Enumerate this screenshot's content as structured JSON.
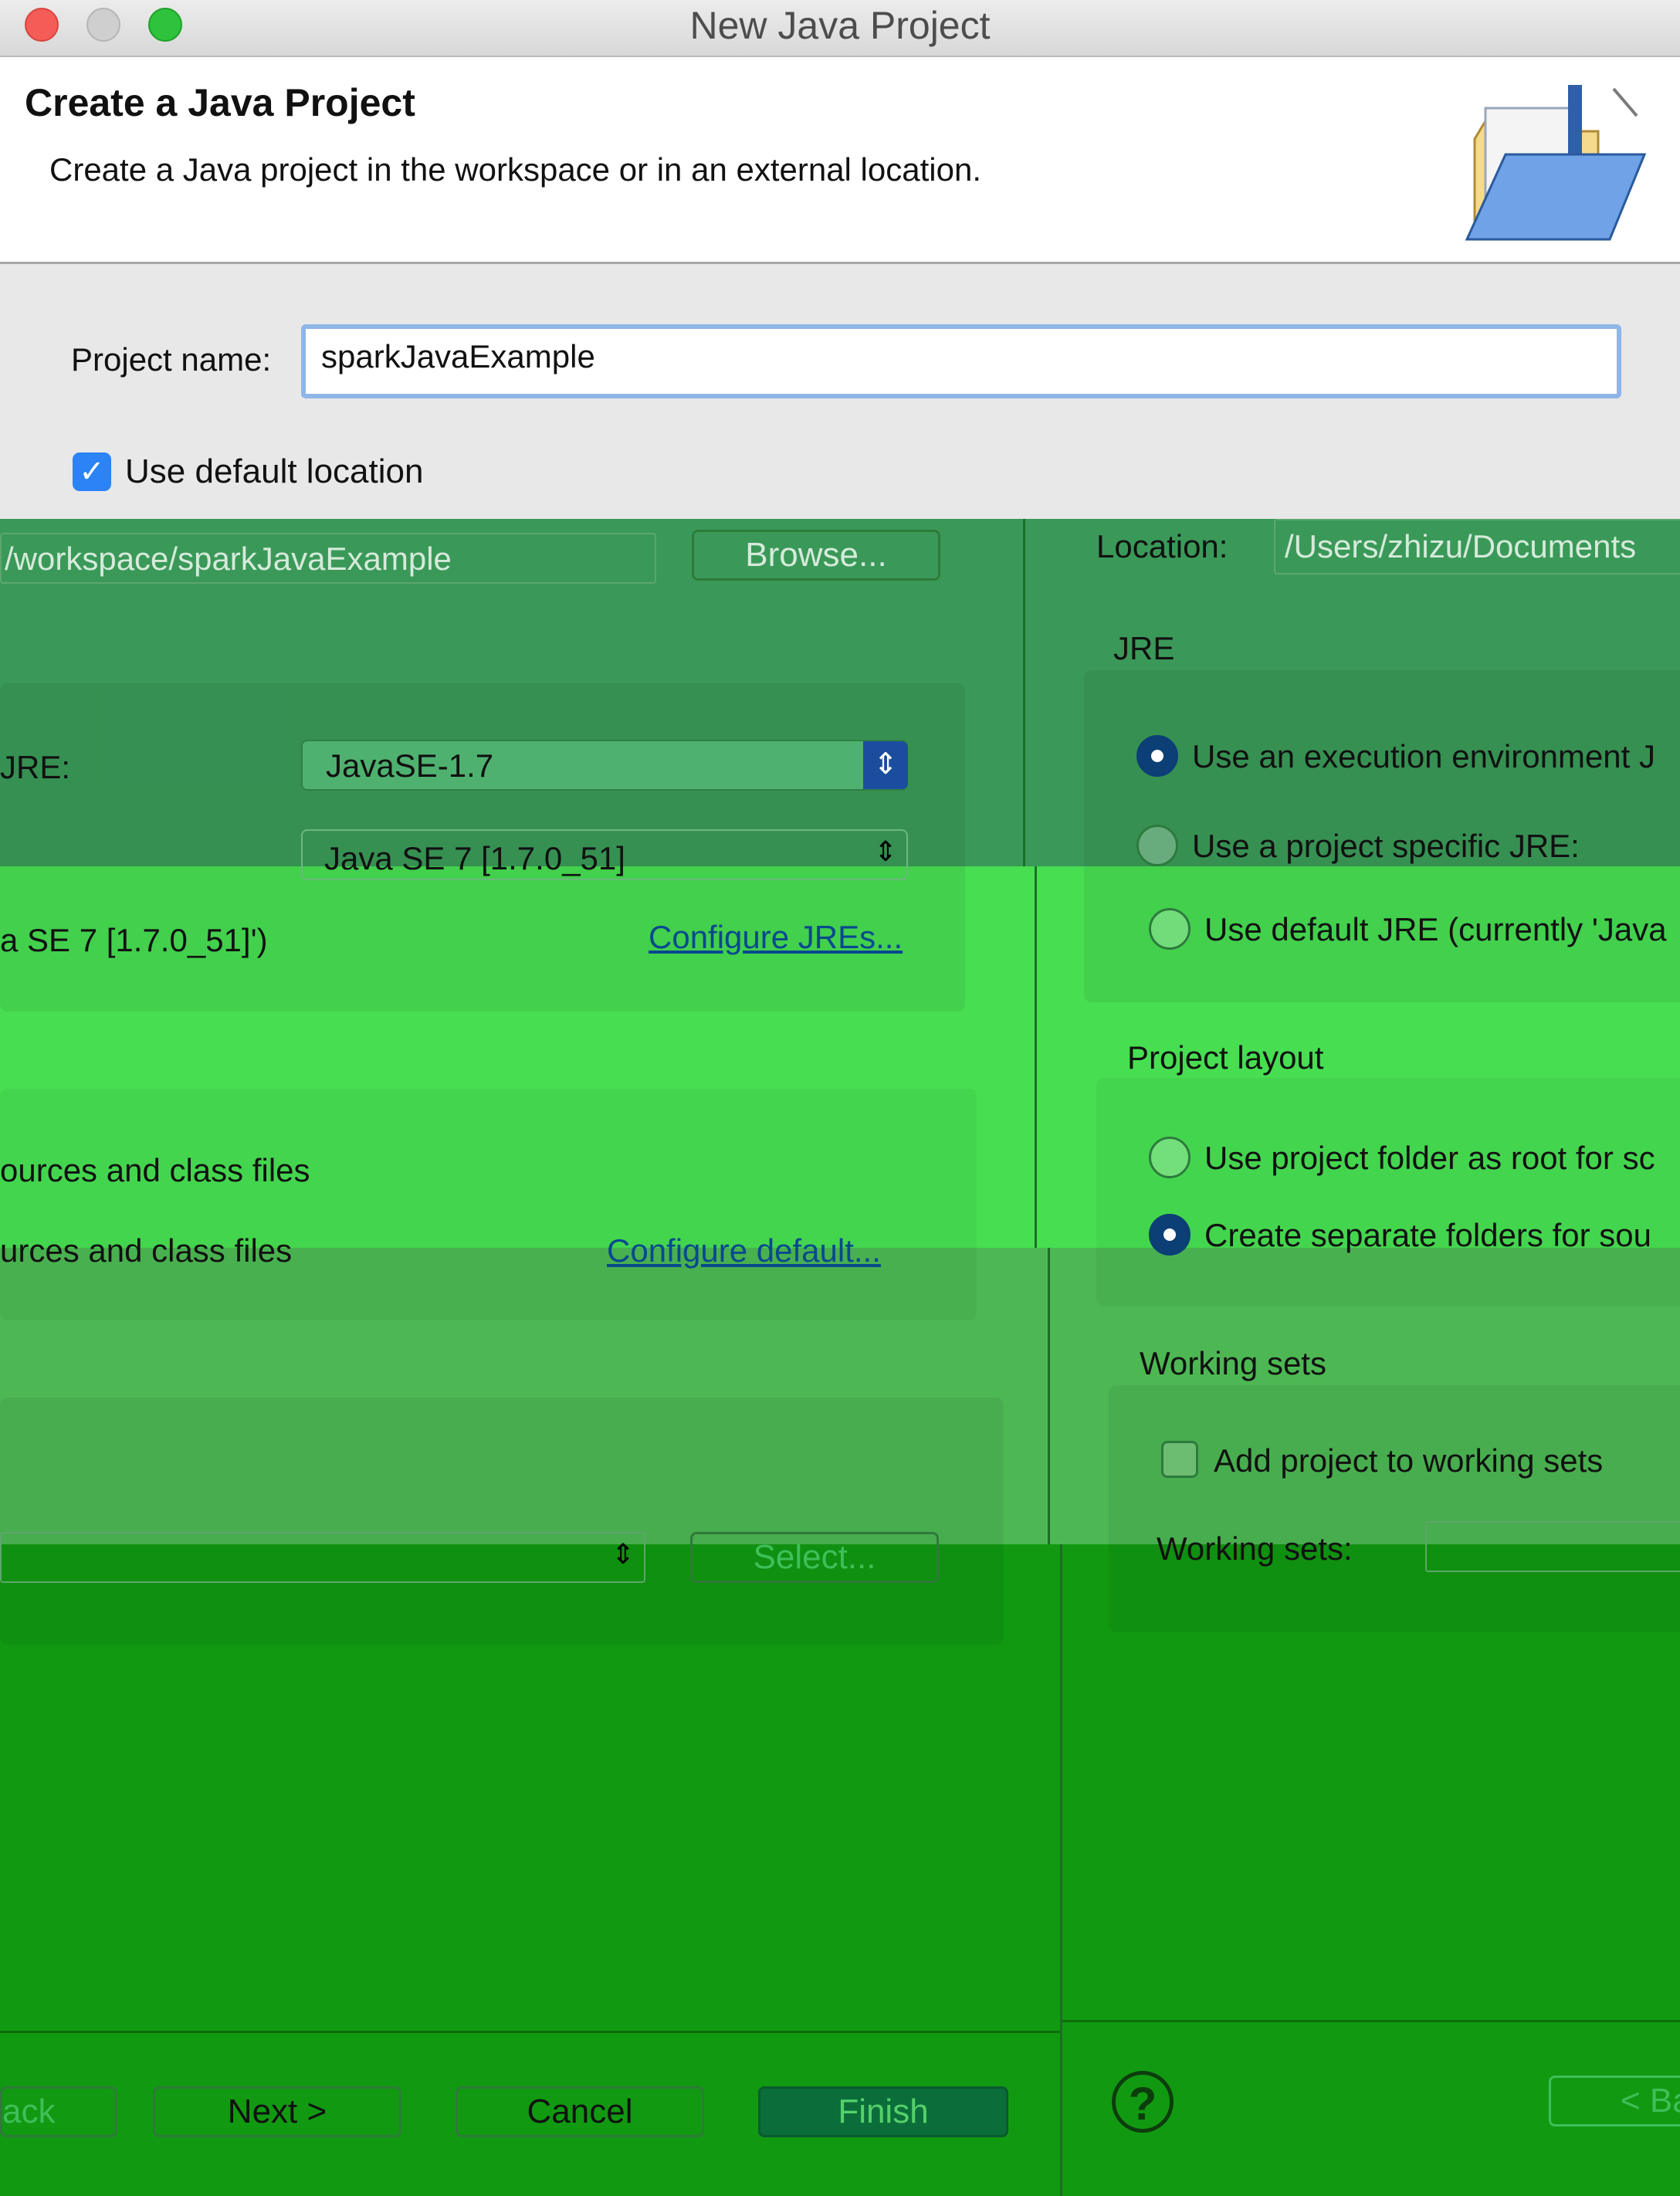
{
  "window": {
    "title": "New Java Project",
    "colors": {
      "close": "#f45c57",
      "minimize": "#cfcfcf",
      "zoom": "#2fc23c"
    }
  },
  "header": {
    "title": "Create a Java Project",
    "description": "Create a Java project in the workspace or in an external location.",
    "icon": "java-project-folder-icon"
  },
  "form": {
    "project_name_label": "Project name:",
    "project_name_value": "sparkJavaExample",
    "use_default_location_label": "Use default location",
    "use_default_location_checked": true
  },
  "left_pane": {
    "location_value": "/workspace/sparkJavaExample",
    "browse_label": "Browse...",
    "jre_label": "JRE:",
    "jre_combo": "JavaSE-1.7",
    "jre_combo_2": "Java SE 7 [1.7.0_51]",
    "default_jre_text": "a SE 7 [1.7.0_51]')",
    "configure_jres_link": "Configure JREs...",
    "layout_option_1": "ources and class files",
    "layout_option_2": "urces and class files",
    "configure_default_link": "Configure default...",
    "select_label": "Select..."
  },
  "right_pane": {
    "location_label": "Location:",
    "location_value": "/Users/zhizu/Documents",
    "jre_section": "JRE",
    "jre_radio_1": "Use an execution environment J",
    "jre_radio_2": "Use a project specific JRE:",
    "jre_radio_3": "Use default JRE (currently 'Java",
    "layout_section": "Project layout",
    "layout_radio_1": "Use project folder as root for sc",
    "layout_radio_2": "Create separate folders for sou",
    "working_sets_section": "Working sets",
    "add_to_working_sets": "Add project to working sets",
    "working_sets_label": "Working sets:"
  },
  "footer": {
    "back_left": "ack",
    "next": "Next >",
    "cancel": "Cancel",
    "finish": "Finish",
    "help_icon": "question-mark-icon",
    "back_right": "< Ba"
  }
}
